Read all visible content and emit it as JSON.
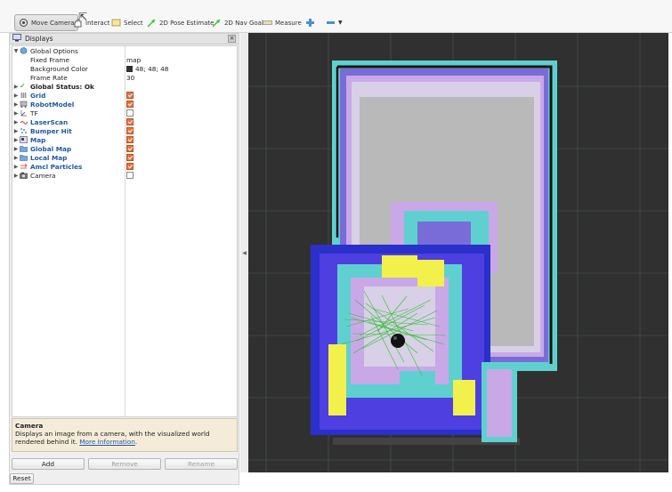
{
  "toolbar": {
    "tools": [
      {
        "label": "Move Camera",
        "active": true
      },
      {
        "label": "Interact"
      },
      {
        "label": "Select"
      },
      {
        "label": "2D Pose Estimate"
      },
      {
        "label": "2D Nav Goal"
      },
      {
        "label": "Measure"
      }
    ]
  },
  "displays_panel": {
    "title": "Displays",
    "global_options": {
      "label": "Global Options",
      "fixed_frame": {
        "label": "Fixed Frame",
        "value": "map"
      },
      "background_color": {
        "label": "Background Color",
        "value": "48; 48; 48",
        "swatch": "#303030"
      },
      "frame_rate": {
        "label": "Frame Rate",
        "value": "30"
      }
    },
    "global_status": {
      "label": "Global Status: Ok"
    },
    "items": [
      {
        "label": "Grid",
        "checked": true
      },
      {
        "label": "RobotModel",
        "checked": true
      },
      {
        "label": "TF",
        "checked": false
      },
      {
        "label": "LaserScan",
        "checked": true
      },
      {
        "label": "Bumper Hit",
        "checked": true
      },
      {
        "label": "Map",
        "checked": true
      },
      {
        "label": "Global Map",
        "checked": true
      },
      {
        "label": "Local Map",
        "checked": true
      },
      {
        "label": "Amcl Particles",
        "checked": true
      },
      {
        "label": "Camera",
        "checked": false
      }
    ],
    "description": {
      "title": "Camera",
      "text": "Displays an image from a camera, with the visualized world rendered behind it.",
      "link": "More Information"
    },
    "buttons": {
      "add": "Add",
      "remove": "Remove",
      "rename": "Rename"
    }
  },
  "footer": {
    "reset": "Reset"
  },
  "colors": {
    "view_background": "#303030",
    "accent_blue": "#1f57a8",
    "checkbox_on": "#e8743b"
  }
}
